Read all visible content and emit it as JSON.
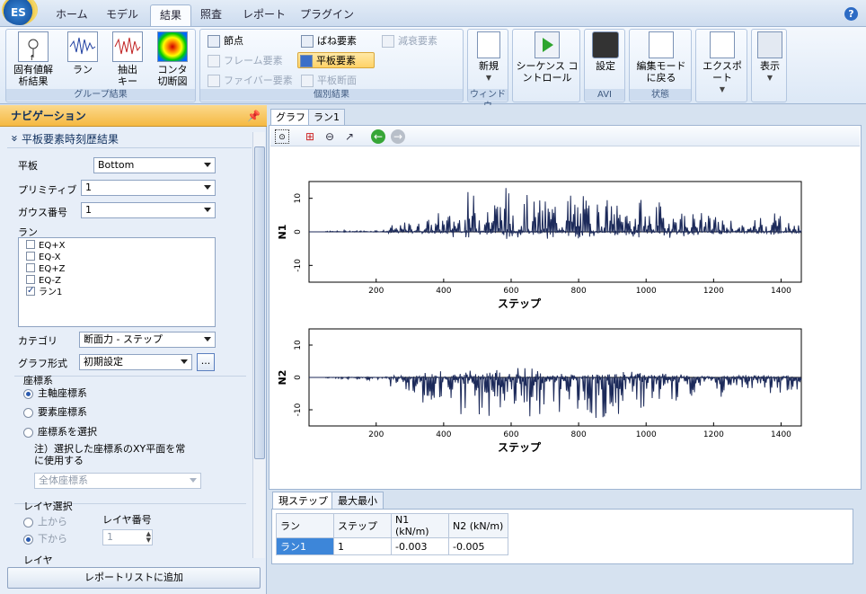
{
  "menu": {
    "logo_text": "ES",
    "tabs": [
      "ホーム",
      "モデル",
      "結果",
      "照査",
      "レポート",
      "プラグイン"
    ],
    "active_tab": "結果",
    "help": "?"
  },
  "ribbon": {
    "group_results": {
      "label": "グループ結果",
      "buttons": [
        "固有値解\n析結果",
        "ラン",
        "抽出\nキー",
        "コンタ\n切断図"
      ]
    },
    "individual": {
      "label": "個別結果",
      "items": [
        {
          "label": "節点",
          "state": "normal"
        },
        {
          "label": "フレーム要素",
          "state": "disabled"
        },
        {
          "label": "ファイバー要素",
          "state": "disabled"
        },
        {
          "label": "ばね要素",
          "state": "normal"
        },
        {
          "label": "平板要素",
          "state": "selected"
        },
        {
          "label": "平板断面",
          "state": "disabled"
        },
        {
          "label": "減衰要素",
          "state": "disabled"
        }
      ]
    },
    "window": {
      "label": "ウィンドウ",
      "new": "新規"
    },
    "sequence": {
      "label": "シーケンス コ\nントロール"
    },
    "avi": {
      "label": "AVI",
      "settings": "設定"
    },
    "status": {
      "label": "状態",
      "edit_back": "編集モード\nに戻る"
    },
    "export": "エクスポート",
    "view": "表示"
  },
  "nav": {
    "title": "ナビゲーション",
    "section": "平板要素時刻歴結果",
    "plate_label": "平板",
    "plate_value": "Bottom",
    "primitive_label": "プリミティブ",
    "primitive_value": "1",
    "gauss_label": "ガウス番号",
    "gauss_value": "1",
    "run_label": "ラン",
    "runs": [
      {
        "name": "EQ+X",
        "checked": false
      },
      {
        "name": "EQ-X",
        "checked": false
      },
      {
        "name": "EQ+Z",
        "checked": false
      },
      {
        "name": "EQ-Z",
        "checked": false
      },
      {
        "name": "ラン1",
        "checked": true
      }
    ],
    "category_label": "カテゴリ",
    "category_value": "断面力 - ステップ",
    "graph_format_label": "グラフ形式",
    "graph_format_value": "初期設定",
    "ellipsis": "...",
    "coord_title": "座標系",
    "coord_options": [
      "主軸座標系",
      "要素座標系",
      "座標系を選択"
    ],
    "coord_selected": 0,
    "coord_note": "注）選択した座標系のXY平面を常\nに使用する",
    "coord_select_value": "全体座標系",
    "layer_title": "レイヤ選択",
    "layer_from_top": "上から",
    "layer_from_bottom": "下から",
    "layer_number_label": "レイヤ番号",
    "layer_number_value": "1",
    "layer_cut": "レイヤ",
    "add_report": "レポートリストに追加"
  },
  "doc_tabs": [
    "グラフ",
    "ラン1"
  ],
  "chart_data": [
    {
      "type": "line",
      "ylabel": "N1",
      "xlabel": "ステップ",
      "xlim": [
        1,
        1460
      ],
      "ylim": [
        -15,
        15
      ],
      "xticks": [
        200,
        400,
        600,
        800,
        1000,
        1200,
        1400
      ],
      "yticks": [
        -10,
        0,
        10
      ],
      "series": [
        {
          "color": "#1c2a5a",
          "values": [
            0,
            0.3,
            0.5,
            0.4,
            0.6,
            2,
            3,
            4,
            6,
            8,
            12,
            13,
            14,
            11,
            10,
            12,
            13,
            11,
            10,
            9,
            10,
            8,
            9,
            7,
            6,
            5,
            4,
            2,
            6,
            8,
            3,
            1
          ]
        }
      ]
    },
    {
      "type": "line",
      "ylabel": "N2",
      "xlabel": "ステップ",
      "xlim": [
        1,
        1460
      ],
      "ylim": [
        -15,
        15
      ],
      "xticks": [
        200,
        400,
        600,
        800,
        1000,
        1200,
        1400
      ],
      "yticks": [
        -10,
        0,
        10
      ],
      "series": [
        {
          "color": "#1c2a5a",
          "values": [
            0,
            -0.3,
            -0.5,
            -0.8,
            -1,
            -3,
            -5,
            -8,
            -10,
            -13,
            -14,
            -12,
            -11,
            -13,
            -12,
            -11,
            -10,
            -12,
            -13,
            -12,
            -11,
            -9,
            -10,
            -8,
            -7,
            -6,
            -5,
            -4,
            -5,
            -6,
            -4,
            -3
          ]
        }
      ]
    }
  ],
  "bottom_tabs": [
    "現ステップ",
    "最大最小"
  ],
  "table": {
    "headers": [
      "ラン",
      "ステップ",
      "N1 (kN/m)",
      "N2 (kN/m)"
    ],
    "rows": [
      [
        "ラン1",
        "1",
        "-0.003",
        "-0.005"
      ]
    ]
  }
}
